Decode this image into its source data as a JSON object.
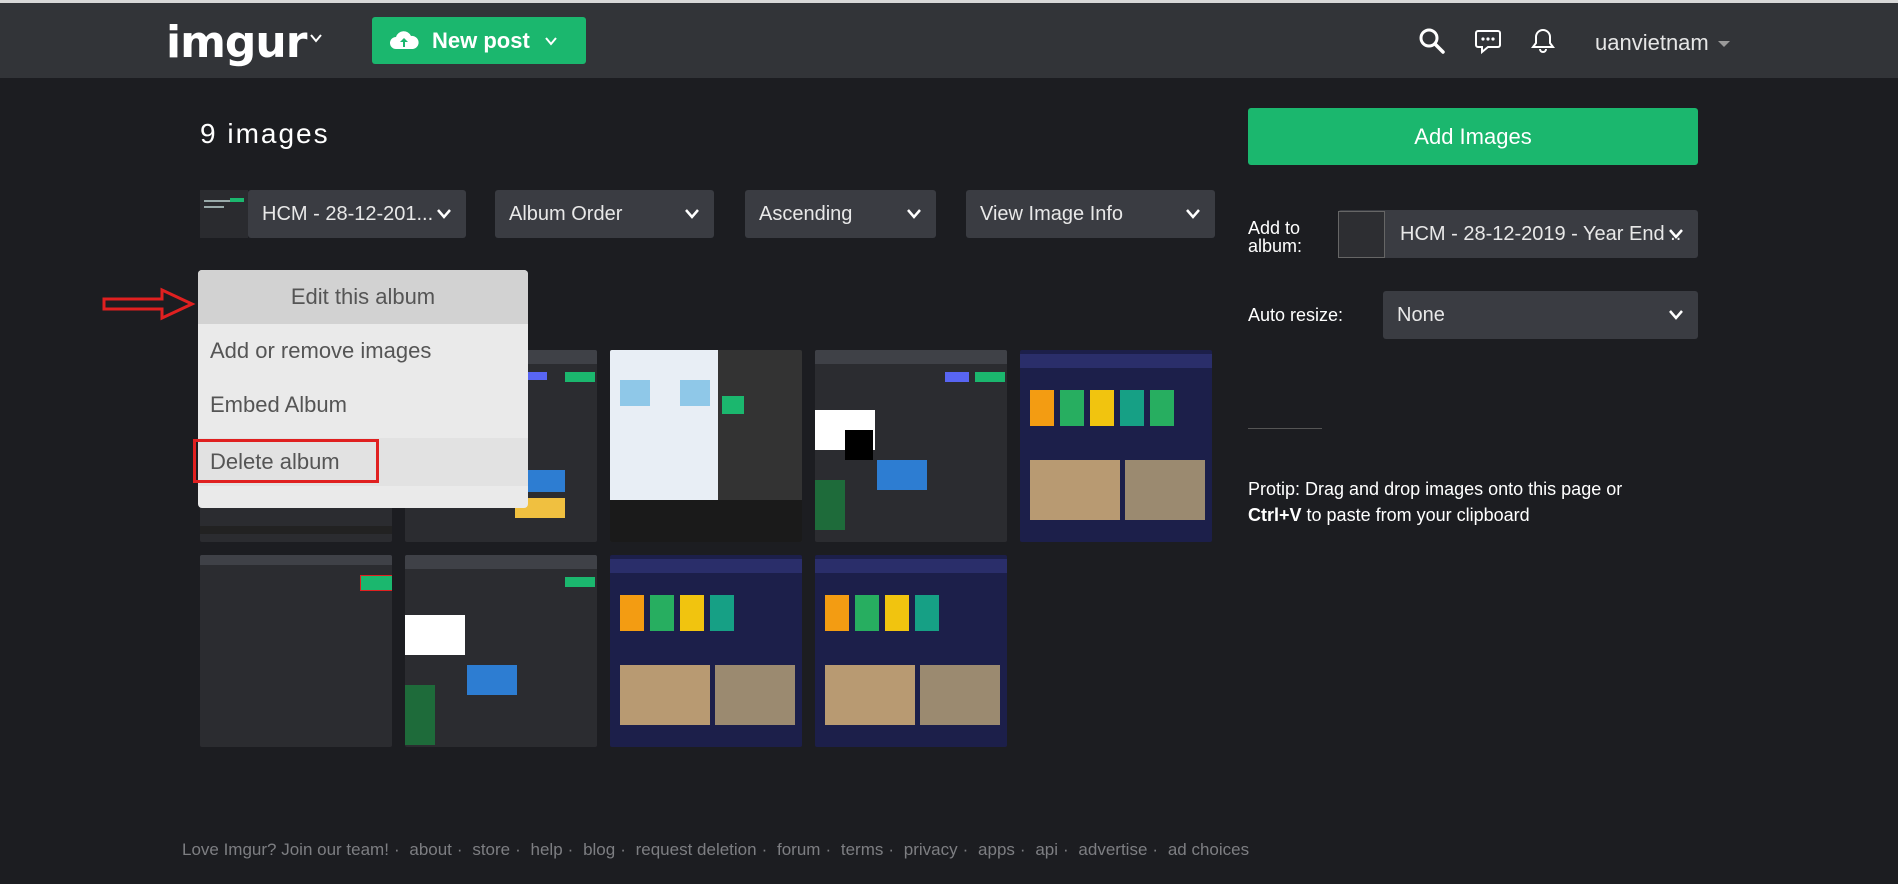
{
  "header": {
    "logo": "imgur",
    "new_post": "New post",
    "username": "uanvietnam"
  },
  "main": {
    "image_count": "9 images",
    "filters": {
      "album": "HCM - 28-12-201...",
      "order": "Album Order",
      "direction": "Ascending",
      "view": "View Image Info"
    },
    "album_menu": {
      "edit": "Edit this album",
      "add_remove": "Add or remove images",
      "embed": "Embed Album",
      "delete": "Delete album"
    }
  },
  "sidebar": {
    "add_images": "Add Images",
    "add_to_album_label": "Add to album:",
    "add_to_album_value": "HCM - 28-12-2019 - Year End ...",
    "auto_resize_label": "Auto resize:",
    "auto_resize_value": "None",
    "protip_1": "Protip: Drag and drop images onto this page or ",
    "protip_key": "Ctrl+V",
    "protip_2": " to paste from your clipboard"
  },
  "footer": {
    "links": [
      "Love Imgur? Join our team!",
      "about",
      "store",
      "help",
      "blog",
      "request deletion",
      "forum",
      "terms",
      "privacy",
      "apps",
      "api",
      "advertise",
      "ad choices"
    ]
  },
  "colors": {
    "accent": "#1bb76e",
    "topbar": "#323438",
    "background": "#1c1d21",
    "highlight": "#e02020"
  }
}
